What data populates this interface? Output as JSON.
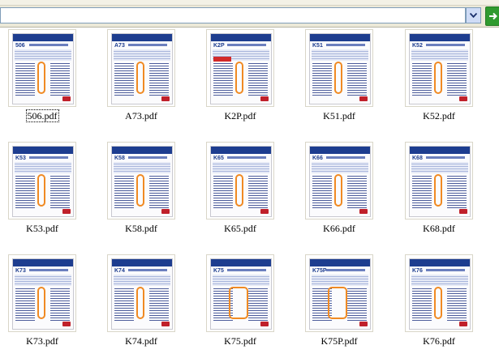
{
  "address_bar": {
    "value": ""
  },
  "colors": {
    "accent": "#1d3d8f",
    "route": "#f08a23",
    "go": "#2f9a2f"
  },
  "icons": {
    "dropdown": "chevron-down-icon",
    "go": "go-arrow-icon",
    "file": "pdf-thumbnail-icon"
  },
  "files": [
    {
      "name": "506.pdf",
      "code": "506"
    },
    {
      "name": "A73.pdf",
      "code": "A73"
    },
    {
      "name": "K2P.pdf",
      "code": "K2P"
    },
    {
      "name": "K51.pdf",
      "code": "K51"
    },
    {
      "name": "K52.pdf",
      "code": "K52"
    },
    {
      "name": "K53.pdf",
      "code": "K53"
    },
    {
      "name": "K58.pdf",
      "code": "K58"
    },
    {
      "name": "K65.pdf",
      "code": "K65"
    },
    {
      "name": "K66.pdf",
      "code": "K66"
    },
    {
      "name": "K68.pdf",
      "code": "K68"
    },
    {
      "name": "K73.pdf",
      "code": "K73"
    },
    {
      "name": "K74.pdf",
      "code": "K74"
    },
    {
      "name": "K75.pdf",
      "code": "K75"
    },
    {
      "name": "K75P.pdf",
      "code": "K75P"
    },
    {
      "name": "K76.pdf",
      "code": "K76"
    }
  ]
}
